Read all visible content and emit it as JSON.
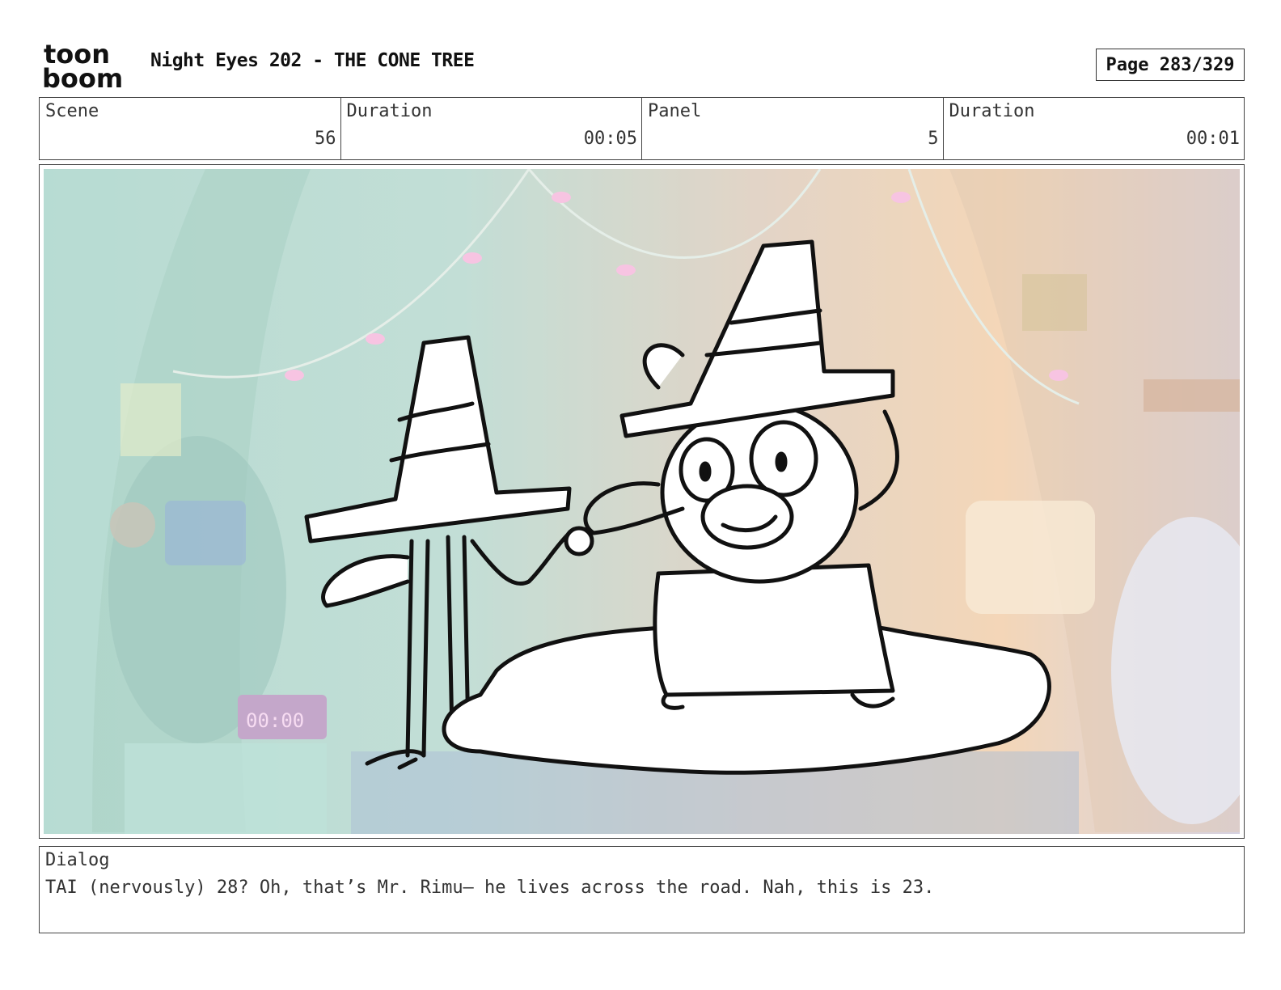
{
  "logo": {
    "line1": "toon",
    "line2": "boom"
  },
  "header": {
    "title": "Night Eyes 202 - THE CONE TREE",
    "page": "Page 283/329"
  },
  "info": {
    "scene_label": "Scene",
    "scene_value": "56",
    "duration_label": "Duration",
    "duration_value": "00:05",
    "panel_label": "Panel",
    "panel_value": "5",
    "panel_duration_label": "Duration",
    "panel_duration_value": "00:01"
  },
  "panel_image": {
    "clock_text": "00:00"
  },
  "dialog": {
    "label": "Dialog",
    "text": "TAI (nervously) 28? Oh, that’s Mr. Rimu— he lives across the road. Nah, this is 23."
  }
}
